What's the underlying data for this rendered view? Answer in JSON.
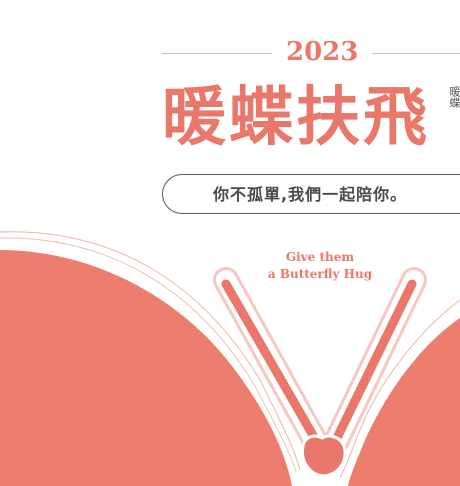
{
  "header": {
    "year": "2023",
    "title": "暖蝶扶飛",
    "side_text": "暖蝶"
  },
  "banner": {
    "slogan": "你不孤單,我們一起陪你。"
  },
  "tagline": {
    "line1": "Give them",
    "line2": "a Butterfly Hug"
  },
  "colors": {
    "accent": "#e9786b",
    "accent_light": "#f0b3a9",
    "text_dark": "#4a4a4a",
    "background": "#ffffff"
  },
  "icons": {
    "butterfly": "butterfly-illustration"
  }
}
